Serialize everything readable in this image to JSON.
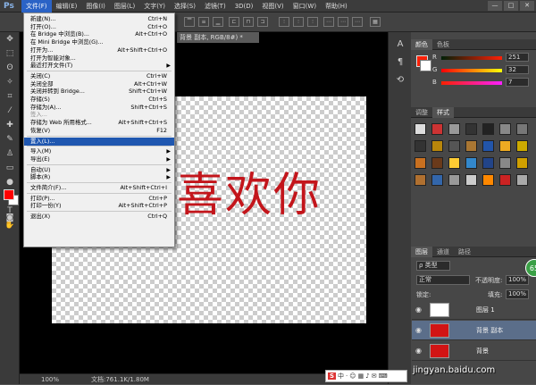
{
  "app": {
    "logo": "Ps"
  },
  "menubar": {
    "items": [
      "文件(F)",
      "编辑(E)",
      "图像(I)",
      "图层(L)",
      "文字(Y)",
      "选择(S)",
      "滤镜(T)",
      "3D(D)",
      "视图(V)",
      "窗口(W)",
      "帮助(H)"
    ],
    "window_buttons": [
      "—",
      "□",
      "✕"
    ]
  },
  "document": {
    "tab": "背景 副本, RGB/8#) *",
    "canvas_text": "喜欢你",
    "text_color": "#c3151b",
    "zoom": "100%",
    "doc_info": "文档:761.1K/1.80M"
  },
  "file_menu": {
    "items": [
      {
        "label": "新建(N)...",
        "shortcut": "Ctrl+N"
      },
      {
        "label": "打开(O)...",
        "shortcut": "Ctrl+O"
      },
      {
        "label": "在 Bridge 中浏览(B)...",
        "shortcut": "Alt+Ctrl+O"
      },
      {
        "label": "在 Mini Bridge 中浏览(G)...",
        "shortcut": ""
      },
      {
        "label": "打开为...",
        "shortcut": "Alt+Shift+Ctrl+O"
      },
      {
        "label": "打开为智能对象...",
        "shortcut": ""
      },
      {
        "label": "最近打开文件(T)",
        "shortcut": "",
        "submenu": true
      },
      {
        "sep": true
      },
      {
        "label": "关闭(C)",
        "shortcut": "Ctrl+W"
      },
      {
        "label": "关闭全部",
        "shortcut": "Alt+Ctrl+W"
      },
      {
        "label": "关闭并转到 Bridge...",
        "shortcut": "Shift+Ctrl+W"
      },
      {
        "label": "存储(S)",
        "shortcut": "Ctrl+S"
      },
      {
        "label": "存储为(A)...",
        "shortcut": "Shift+Ctrl+S"
      },
      {
        "label": "签入...",
        "shortcut": "",
        "disabled": true
      },
      {
        "label": "存储为 Web 所用格式...",
        "shortcut": "Alt+Shift+Ctrl+S"
      },
      {
        "label": "恢复(V)",
        "shortcut": "F12"
      },
      {
        "sep": true
      },
      {
        "label": "置入(L)...",
        "shortcut": "",
        "highlighted": true
      },
      {
        "sep": true
      },
      {
        "label": "导入(M)",
        "shortcut": "",
        "submenu": true
      },
      {
        "label": "导出(E)",
        "shortcut": "",
        "submenu": true
      },
      {
        "sep": true
      },
      {
        "label": "自动(U)",
        "shortcut": "",
        "submenu": true
      },
      {
        "label": "脚本(R)",
        "shortcut": "",
        "submenu": true
      },
      {
        "sep": true
      },
      {
        "label": "文件简介(F)...",
        "shortcut": "Alt+Shift+Ctrl+I"
      },
      {
        "sep": true
      },
      {
        "label": "打印(P)...",
        "shortcut": "Ctrl+P"
      },
      {
        "label": "打印一份(Y)",
        "shortcut": "Alt+Shift+Ctrl+P"
      },
      {
        "sep": true
      },
      {
        "label": "退出(X)",
        "shortcut": "Ctrl+Q"
      }
    ]
  },
  "color_panel": {
    "tabs": [
      "颜色",
      "色板"
    ],
    "channels": [
      {
        "name": "R",
        "value": "251"
      },
      {
        "name": "G",
        "value": "32"
      },
      {
        "name": "B",
        "value": "7"
      }
    ],
    "foreground": "#fb2007"
  },
  "styles_panel": {
    "tabs": [
      "调整",
      "样式"
    ]
  },
  "layers_panel": {
    "tabs": [
      "图层",
      "通道",
      "路径"
    ],
    "kind_label": "ρ 类型",
    "blend_mode": "正常",
    "opacity_label": "不透明度:",
    "opacity_value": "100%",
    "lock_label": "锁定:",
    "fill_label": "填充:",
    "fill_value": "100%",
    "layers": [
      {
        "name": "图层 1",
        "selected": false,
        "thumb": "#ffffff"
      },
      {
        "name": "背景 副本",
        "selected": true,
        "thumb": "#d21414"
      },
      {
        "name": "背景",
        "selected": false,
        "thumb": "#d21414"
      }
    ]
  },
  "taskbar": {
    "items": [
      "S",
      "中",
      "·",
      "☺",
      "▦",
      "♪",
      "✉",
      "⌨"
    ]
  },
  "watermark": "jingyan.baidu.com",
  "badge": "65"
}
